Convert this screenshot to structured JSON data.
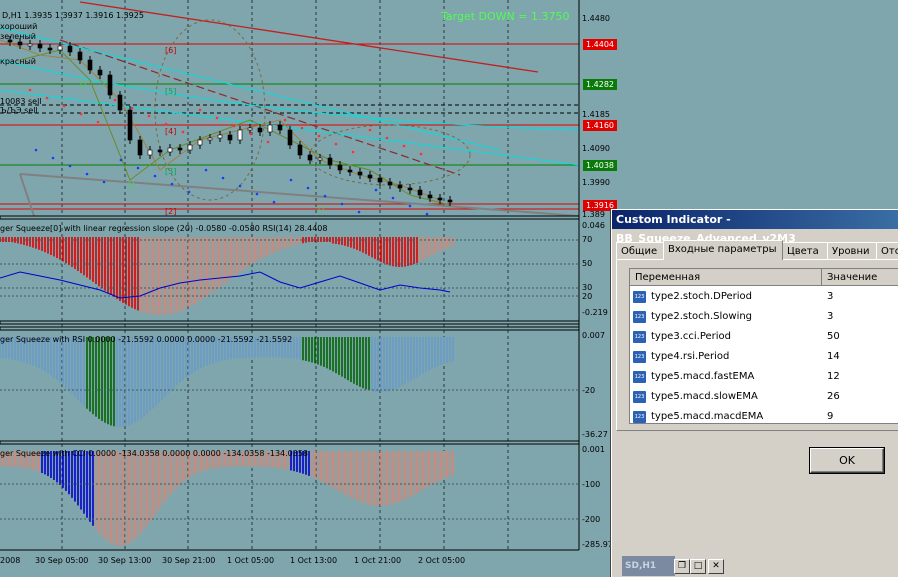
{
  "chart": {
    "symbol_ohlc": "D,H1  1.3935 1.3937 1.3916 1.3925",
    "target_text": "Target DOWN = 1.3750",
    "legend_lines": [
      "хороший",
      "зеленый",
      "красный"
    ],
    "side_notes": [
      "10083 sell",
      "Ъ/ЪЭ sell"
    ],
    "price_axis_top": [
      "1.4480",
      "1.4185",
      "1.4090",
      "1.3990",
      "1.389"
    ],
    "price_labels": [
      {
        "value": "1.4404",
        "color": "red"
      },
      {
        "value": "1.4282",
        "color": "green"
      },
      {
        "value": "1.4160",
        "color": "red"
      },
      {
        "value": "1.4038",
        "color": "green"
      },
      {
        "value": "1.3916",
        "color": "red"
      }
    ],
    "level_tags": [
      "[6]",
      "[5]",
      "[4]",
      "[3]",
      "[2]"
    ],
    "wave_tags": [
      "[]",
      "[]",
      "[]"
    ]
  },
  "panels": {
    "p1": {
      "title": "ger Squeeze[0] with linear regression slope (20) -0.0580 -0.0580  RSI(14) 28.4408",
      "axis": [
        "0.046",
        "70",
        "50",
        "30",
        "20",
        "-0.219"
      ]
    },
    "p2": {
      "title": "ger Squeeze with RSI  0.0000 -21.5592 0.0000 0.0000 -21.5592 -21.5592",
      "axis": [
        "0.007",
        "-20",
        "-36.27"
      ]
    },
    "p3": {
      "title": "ger Squeeze with CCI  0.0000 -134.0358 0.0000 0.0000 -134.0358 -134.0358",
      "axis": [
        "0.001",
        "-100",
        "-200",
        "-285.974"
      ]
    }
  },
  "time_axis": [
    "2008",
    "30 Sep 05:00",
    "30 Sep 13:00",
    "30 Sep 21:00",
    "1 Oct 05:00",
    "1 Oct 13:00",
    "1 Oct 21:00",
    "2 Oct 05:00"
  ],
  "dialog": {
    "title": "Custom Indicator - BB_Squeeze_Advanced_v2M3",
    "tabs": [
      "Общие",
      "Входные параметры",
      "Цвета",
      "Уровни",
      "Отс"
    ],
    "col_variable": "Переменная",
    "col_value": "Значение",
    "icon_text": "123",
    "rows": [
      {
        "name": "type2.stoch.DPeriod",
        "value": "3"
      },
      {
        "name": "type2.stoch.Slowing",
        "value": "3"
      },
      {
        "name": "type3.cci.Period",
        "value": "50"
      },
      {
        "name": "type4.rsi.Period",
        "value": "14"
      },
      {
        "name": "type5.macd.fastEMA",
        "value": "12"
      },
      {
        "name": "type5.macd.slowEMA",
        "value": "26"
      },
      {
        "name": "type5.macd.macdEMA",
        "value": "9"
      }
    ],
    "ok_label": "OK"
  },
  "taskbar": {
    "label": "SD,H1"
  },
  "colors": {
    "bg": "#7fa6ad",
    "bull": "#ff0000",
    "bear": "#0000ff",
    "green_hist": "#006400",
    "steel_hist": "#6a9bc9",
    "salmon_hist": "#d08878"
  }
}
